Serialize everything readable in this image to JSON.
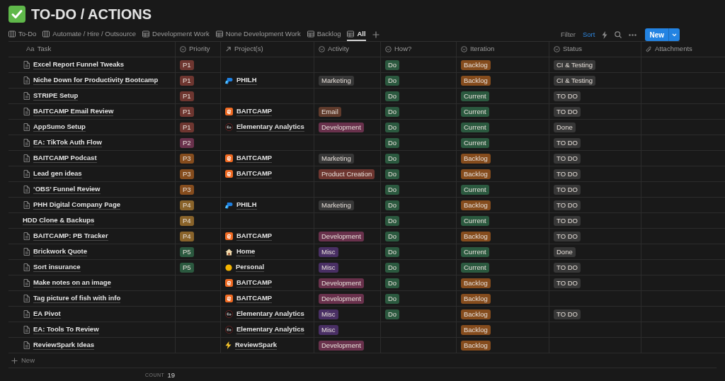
{
  "page": {
    "title": "TO-DO / ACTIONS"
  },
  "tabs": [
    {
      "label": "To-Do",
      "kind": "board",
      "selected": false
    },
    {
      "label": "Automate / Hire / Outsource",
      "kind": "board",
      "selected": false
    },
    {
      "label": "Development Work",
      "kind": "table",
      "selected": false
    },
    {
      "label": "None Development Work",
      "kind": "table",
      "selected": false
    },
    {
      "label": "Backlog",
      "kind": "table",
      "selected": false
    },
    {
      "label": "All",
      "kind": "table",
      "selected": true
    }
  ],
  "toolbar": {
    "filter": {
      "label": "Filter",
      "active": false
    },
    "sort": {
      "label": "Sort",
      "active": true
    },
    "new_button": "New"
  },
  "table": {
    "columns": [
      {
        "label": "Task",
        "kind": "title",
        "prefix": "Aa"
      },
      {
        "label": "Priority",
        "kind": "select"
      },
      {
        "label": "Project(s)",
        "kind": "relation"
      },
      {
        "label": "Activity",
        "kind": "select"
      },
      {
        "label": "How?",
        "kind": "select"
      },
      {
        "label": "Iteration",
        "kind": "select"
      },
      {
        "label": "Status",
        "kind": "select"
      },
      {
        "label": "Attachments",
        "kind": "file"
      }
    ],
    "rows": [
      {
        "task": "Excel Report Funnel Tweaks",
        "kind": "page",
        "priority": {
          "text": "P1",
          "color": "#6e3630"
        },
        "how": {
          "text": "Do",
          "color": "#2b593f"
        },
        "iteration": {
          "text": "Backlog",
          "color": "#854c1d"
        },
        "status": {
          "text": "CI & Testing",
          "color": "#373737"
        }
      },
      {
        "task": "Niche Down for Productivity Bootcamp",
        "kind": "page",
        "priority": {
          "text": "P1",
          "color": "#6e3630"
        },
        "project": {
          "name": "PHILH",
          "kind": "philh"
        },
        "activity": {
          "text": "Marketing",
          "color": "#373737"
        },
        "how": {
          "text": "Do",
          "color": "#2b593f"
        },
        "iteration": {
          "text": "Backlog",
          "color": "#854c1d"
        },
        "status": {
          "text": "CI & Testing",
          "color": "#373737"
        }
      },
      {
        "task": "STRIPE Setup",
        "kind": "page",
        "priority": {
          "text": "P1",
          "color": "#6e3630"
        },
        "how": {
          "text": "Do",
          "color": "#2b593f"
        },
        "iteration": {
          "text": "Current",
          "color": "#2b593f"
        },
        "status": {
          "text": "TO DO",
          "color": "#373737"
        }
      },
      {
        "task": "BAITCAMP Email Review",
        "kind": "page",
        "priority": {
          "text": "P1",
          "color": "#6e3630"
        },
        "project": {
          "name": "BAITCAMP",
          "kind": "baitcamp"
        },
        "activity": {
          "text": "Email",
          "color": "#603b2c"
        },
        "how": {
          "text": "Do",
          "color": "#2b593f"
        },
        "iteration": {
          "text": "Current",
          "color": "#2b593f"
        },
        "status": {
          "text": "TO DO",
          "color": "#373737"
        }
      },
      {
        "task": "AppSumo Setup",
        "kind": "page",
        "priority": {
          "text": "P1",
          "color": "#6e3630"
        },
        "project": {
          "name": "Elementary Analytics",
          "kind": "ea"
        },
        "activity": {
          "text": "Development",
          "color": "#69314c"
        },
        "how": {
          "text": "Do",
          "color": "#2b593f"
        },
        "iteration": {
          "text": "Current",
          "color": "#2b593f"
        },
        "status": {
          "text": "Done",
          "color": "#373737"
        }
      },
      {
        "task": "EA: TikTok Auth Flow",
        "kind": "page",
        "priority": {
          "text": "P2",
          "color": "#69314c"
        },
        "how": {
          "text": "Do",
          "color": "#2b593f"
        },
        "iteration": {
          "text": "Current",
          "color": "#2b593f"
        },
        "status": {
          "text": "TO DO",
          "color": "#373737"
        }
      },
      {
        "task": "BAITCAMP Podcast",
        "kind": "page",
        "priority": {
          "text": "P3",
          "color": "#854c1d"
        },
        "project": {
          "name": "BAITCAMP",
          "kind": "baitcamp"
        },
        "activity": {
          "text": "Marketing",
          "color": "#373737"
        },
        "how": {
          "text": "Do",
          "color": "#2b593f"
        },
        "iteration": {
          "text": "Backlog",
          "color": "#854c1d"
        },
        "status": {
          "text": "TO DO",
          "color": "#373737"
        }
      },
      {
        "task": "Lead gen ideas",
        "kind": "page",
        "priority": {
          "text": "P3",
          "color": "#854c1d"
        },
        "project": {
          "name": "BAITCAMP",
          "kind": "baitcamp"
        },
        "activity": {
          "text": "Product Creation",
          "color": "#6e3630"
        },
        "how": {
          "text": "Do",
          "color": "#2b593f"
        },
        "iteration": {
          "text": "Backlog",
          "color": "#854c1d"
        },
        "status": {
          "text": "TO DO",
          "color": "#373737"
        }
      },
      {
        "task": "‘OBS’ Funnel Review",
        "kind": "page",
        "priority": {
          "text": "P3",
          "color": "#854c1d"
        },
        "how": {
          "text": "Do",
          "color": "#2b593f"
        },
        "iteration": {
          "text": "Current",
          "color": "#2b593f"
        },
        "status": {
          "text": "TO DO",
          "color": "#373737"
        }
      },
      {
        "task": "PHH Digital Company Page",
        "kind": "page",
        "priority": {
          "text": "P4",
          "color": "#89632a"
        },
        "project": {
          "name": "PHILH",
          "kind": "philh"
        },
        "activity": {
          "text": "Marketing",
          "color": "#373737"
        },
        "how": {
          "text": "Do",
          "color": "#2b593f"
        },
        "iteration": {
          "text": "Backlog",
          "color": "#854c1d"
        },
        "status": {
          "text": "TO DO",
          "color": "#373737"
        }
      },
      {
        "task": "HDD Clone & Backups",
        "kind": "plain",
        "priority": {
          "text": "P4",
          "color": "#89632a"
        },
        "how": {
          "text": "Do",
          "color": "#2b593f"
        },
        "iteration": {
          "text": "Current",
          "color": "#2b593f"
        },
        "status": {
          "text": "TO DO",
          "color": "#373737"
        }
      },
      {
        "task": "BAITCAMP: PB Tracker",
        "kind": "page",
        "priority": {
          "text": "P4",
          "color": "#89632a"
        },
        "project": {
          "name": "BAITCAMP",
          "kind": "baitcamp"
        },
        "activity": {
          "text": "Development",
          "color": "#69314c"
        },
        "how": {
          "text": "Do",
          "color": "#2b593f"
        },
        "iteration": {
          "text": "Backlog",
          "color": "#854c1d"
        },
        "status": {
          "text": "TO DO",
          "color": "#373737"
        }
      },
      {
        "task": "Brickwork Quote",
        "kind": "page",
        "priority": {
          "text": "P5",
          "color": "#2b593f"
        },
        "project": {
          "name": "Home",
          "kind": "home"
        },
        "activity": {
          "text": "Misc",
          "color": "#492f64"
        },
        "how": {
          "text": "Do",
          "color": "#2b593f"
        },
        "iteration": {
          "text": "Current",
          "color": "#2b593f"
        },
        "status": {
          "text": "Done",
          "color": "#373737"
        }
      },
      {
        "task": "Sort insurance",
        "kind": "page",
        "priority": {
          "text": "P5",
          "color": "#2b593f"
        },
        "project": {
          "name": "Personal",
          "kind": "personal"
        },
        "activity": {
          "text": "Misc",
          "color": "#492f64"
        },
        "how": {
          "text": "Do",
          "color": "#2b593f"
        },
        "iteration": {
          "text": "Current",
          "color": "#2b593f"
        },
        "status": {
          "text": "TO DO",
          "color": "#373737"
        }
      },
      {
        "task": "Make notes on an image",
        "kind": "page",
        "project": {
          "name": "BAITCAMP",
          "kind": "baitcamp"
        },
        "activity": {
          "text": "Development",
          "color": "#69314c"
        },
        "how": {
          "text": "Do",
          "color": "#2b593f"
        },
        "iteration": {
          "text": "Backlog",
          "color": "#854c1d"
        },
        "status": {
          "text": "TO DO",
          "color": "#373737"
        }
      },
      {
        "task": "Tag picture of fish with info",
        "kind": "page",
        "project": {
          "name": "BAITCAMP",
          "kind": "baitcamp"
        },
        "activity": {
          "text": "Development",
          "color": "#69314c"
        },
        "how": {
          "text": "Do",
          "color": "#2b593f"
        },
        "iteration": {
          "text": "Backlog",
          "color": "#854c1d"
        }
      },
      {
        "task": "EA Pivot",
        "kind": "page",
        "project": {
          "name": "Elementary Analytics",
          "kind": "ea"
        },
        "activity": {
          "text": "Misc",
          "color": "#492f64"
        },
        "how": {
          "text": "Do",
          "color": "#2b593f"
        },
        "iteration": {
          "text": "Backlog",
          "color": "#854c1d"
        },
        "status": {
          "text": "TO DO",
          "color": "#373737"
        }
      },
      {
        "task": "EA: Tools To Review",
        "kind": "page",
        "project": {
          "name": "Elementary Analytics",
          "kind": "ea"
        },
        "activity": {
          "text": "Misc",
          "color": "#492f64"
        },
        "iteration": {
          "text": "Backlog",
          "color": "#854c1d"
        }
      },
      {
        "task": "ReviewSpark Ideas",
        "kind": "page",
        "project": {
          "name": "ReviewSpark",
          "kind": "reviewspark"
        },
        "activity": {
          "text": "Development",
          "color": "#69314c"
        },
        "iteration": {
          "text": "Backlog",
          "color": "#854c1d"
        }
      }
    ],
    "new_row": "New",
    "footer": {
      "label": "COUNT",
      "value": "19"
    }
  }
}
